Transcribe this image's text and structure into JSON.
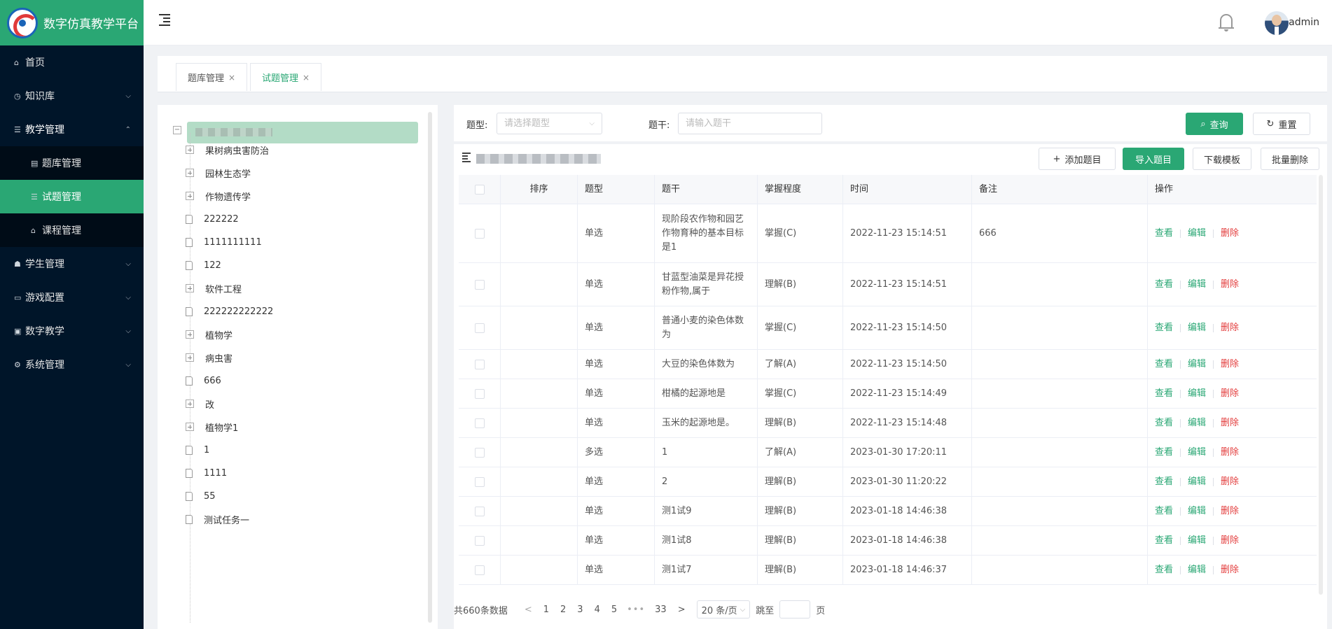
{
  "app": {
    "title": "数字仿真教学平台"
  },
  "sidebar": {
    "items": [
      {
        "label": "首页",
        "icon": "home-icon"
      },
      {
        "label": "知识库",
        "icon": "knowledge-icon"
      },
      {
        "label": "教学管理",
        "icon": "menu-icon"
      },
      {
        "label": "学生管理",
        "icon": "student-icon"
      },
      {
        "label": "游戏配置",
        "icon": "monitor-icon"
      },
      {
        "label": "数字教学",
        "icon": "image-icon"
      },
      {
        "label": "系统管理",
        "icon": "gear-icon"
      }
    ],
    "submenu": [
      {
        "label": "题库管理",
        "icon": "table-icon"
      },
      {
        "label": "试题管理",
        "icon": "list-icon"
      },
      {
        "label": "课程管理",
        "icon": "home-icon"
      }
    ]
  },
  "header": {
    "username": "admin"
  },
  "tabs": [
    {
      "label": "题库管理",
      "close": "×"
    },
    {
      "label": "试题管理",
      "close": "×"
    }
  ],
  "tree": {
    "nodes": [
      {
        "label": "果树病虫害防治",
        "icon": "plus"
      },
      {
        "label": "园林生态学",
        "icon": "plus"
      },
      {
        "label": "作物遗传学",
        "icon": "plus"
      },
      {
        "label": "222222",
        "icon": "file"
      },
      {
        "label": "1111111111",
        "icon": "file"
      },
      {
        "label": "122",
        "icon": "file"
      },
      {
        "label": "软件工程",
        "icon": "plus"
      },
      {
        "label": "222222222222",
        "icon": "file"
      },
      {
        "label": "植物学",
        "icon": "plus"
      },
      {
        "label": "病虫害",
        "icon": "plus"
      },
      {
        "label": "666",
        "icon": "file"
      },
      {
        "label": "改",
        "icon": "plus"
      },
      {
        "label": "植物学1",
        "icon": "plus"
      },
      {
        "label": "1",
        "icon": "file"
      },
      {
        "label": "1111",
        "icon": "file"
      },
      {
        "label": "55",
        "icon": "file"
      },
      {
        "label": "测试任务一",
        "icon": "file"
      }
    ]
  },
  "filters": {
    "type_label": "题型:",
    "type_placeholder": "请选择题型",
    "stem_label": "题干:",
    "stem_placeholder": "请输入题干",
    "search_label": "查询",
    "reset_label": "重置"
  },
  "toolbar": {
    "add_label": "添加题目",
    "import_label": "导入题目",
    "download_label": "下载模板",
    "batch_delete_label": "批量删除"
  },
  "table": {
    "columns": [
      "排序",
      "题型",
      "题干",
      "掌握程度",
      "时间",
      "备注",
      "操作"
    ],
    "actions": {
      "view": "查看",
      "edit": "编辑",
      "delete": "删除"
    },
    "rows": [
      {
        "type": "单选",
        "stem": "现阶段农作物和园艺作物育种的基本目标是1",
        "level": "掌握(C)",
        "time": "2022-11-23 15:14:51",
        "note": "666"
      },
      {
        "type": "单选",
        "stem": "甘蓝型油菜是异花授粉作物,属于",
        "level": "理解(B)",
        "time": "2022-11-23 15:14:51",
        "note": ""
      },
      {
        "type": "单选",
        "stem": "普通小麦的染色体数为",
        "level": "掌握(C)",
        "time": "2022-11-23 15:14:50",
        "note": ""
      },
      {
        "type": "单选",
        "stem": "大豆的染色体数为",
        "level": "了解(A)",
        "time": "2022-11-23 15:14:50",
        "note": ""
      },
      {
        "type": "单选",
        "stem": "柑橘的起源地是",
        "level": "掌握(C)",
        "time": "2022-11-23 15:14:49",
        "note": ""
      },
      {
        "type": "单选",
        "stem": "玉米的起源地是。",
        "level": "理解(B)",
        "time": "2022-11-23 15:14:48",
        "note": ""
      },
      {
        "type": "多选",
        "stem": "1",
        "level": "了解(A)",
        "time": "2023-01-30 17:20:11",
        "note": ""
      },
      {
        "type": "单选",
        "stem": "2",
        "level": "理解(B)",
        "time": "2023-01-30 11:20:22",
        "note": ""
      },
      {
        "type": "单选",
        "stem": "测1试9",
        "level": "理解(B)",
        "time": "2023-01-18 14:46:38",
        "note": ""
      },
      {
        "type": "单选",
        "stem": "测1试8",
        "level": "理解(B)",
        "time": "2023-01-18 14:46:38",
        "note": ""
      },
      {
        "type": "单选",
        "stem": "测1试7",
        "level": "理解(B)",
        "time": "2023-01-18 14:46:37",
        "note": ""
      }
    ]
  },
  "pagination": {
    "total": "共660条数据",
    "prev": "<",
    "next": ">",
    "pages": [
      "1",
      "2",
      "3",
      "4",
      "5"
    ],
    "ellipsis": "•••",
    "last": "33",
    "page_size": "20 条/页",
    "jump_label": "跳至",
    "page_unit": "页"
  },
  "colors": {
    "primary": "#2aa774",
    "sidebar_bg": "#001529",
    "danger": "#e33e3e"
  }
}
